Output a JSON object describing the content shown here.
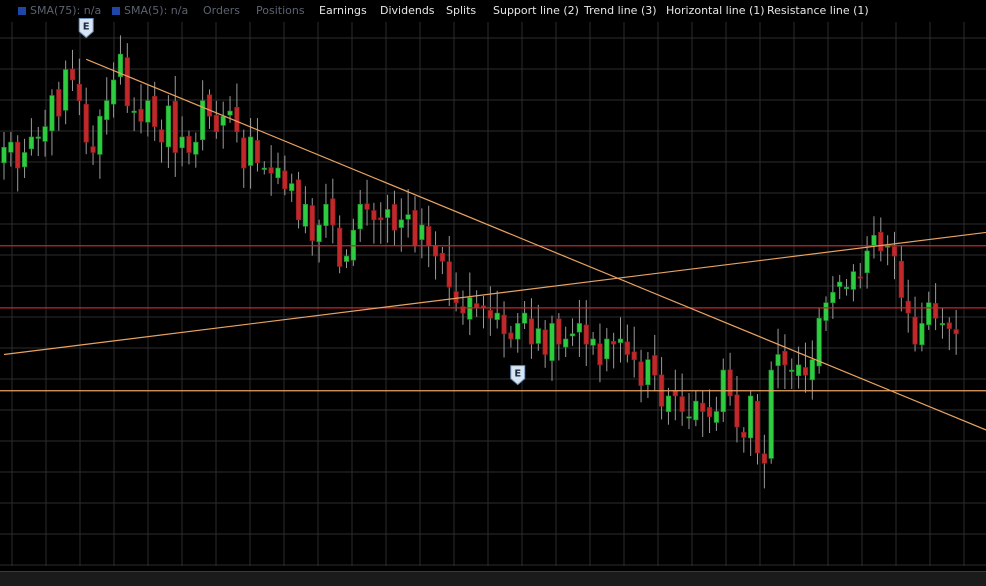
{
  "toolbar": {
    "items": [
      {
        "label": "SMA(75): n/a",
        "swatch": "#1e46a8",
        "style": "dim"
      },
      {
        "label": "SMA(5): n/a",
        "swatch": "#1e46a8",
        "style": "dim"
      },
      {
        "label": "Orders",
        "style": "dim"
      },
      {
        "label": "Positions",
        "style": "dim"
      },
      {
        "label": "Earnings",
        "style": "bright"
      },
      {
        "label": "Dividends",
        "style": "bright"
      },
      {
        "label": "Splits",
        "style": "bright"
      },
      {
        "label": "Support line (2)",
        "style": "bright"
      },
      {
        "label": "Trend line (3)",
        "style": "bright"
      },
      {
        "label": "Horizontal line (1)",
        "style": "bright"
      },
      {
        "label": "Resistance line (1)",
        "style": "bright"
      }
    ]
  },
  "chart_data": {
    "type": "candlestick",
    "colors": {
      "up": "#2ecc40",
      "down": "#c0282a",
      "wick": "#9a9a9a",
      "grid": "#2c2c2c",
      "trend": "#e8a262",
      "resistance": "#c0282a",
      "support": "#e8a262"
    },
    "ylim": [
      0,
      100
    ],
    "grid": true,
    "candles_count": 139,
    "closes": [
      76,
      77,
      72,
      75,
      78,
      78,
      80,
      86,
      82,
      91,
      89,
      85,
      77,
      75,
      82,
      85,
      89,
      94,
      84,
      83,
      81,
      85,
      80,
      77,
      84,
      75,
      78,
      75,
      77,
      85,
      82,
      79,
      82,
      83,
      79,
      72,
      78,
      73,
      72,
      71,
      72,
      68,
      69,
      62,
      65,
      58,
      61,
      65,
      61,
      53,
      55,
      60,
      65,
      64,
      62,
      62,
      64,
      60,
      62,
      63,
      57,
      61,
      57,
      55,
      54,
      49,
      46,
      44,
      47,
      45,
      45,
      43,
      44,
      40,
      39,
      42,
      44,
      38,
      41,
      36,
      42,
      38,
      39,
      40,
      42,
      38,
      39,
      34,
      39,
      38,
      39,
      36,
      35,
      30,
      35,
      32,
      26,
      28,
      28,
      25,
      24,
      27,
      25,
      24,
      25,
      33,
      28,
      22,
      20,
      28,
      17,
      15,
      33,
      36,
      34,
      33,
      34,
      32,
      35,
      43,
      46,
      48,
      50,
      49,
      52,
      51,
      56,
      59,
      56,
      57,
      55,
      47,
      44,
      38,
      42,
      46,
      43,
      42,
      41,
      40
    ],
    "events": [
      {
        "label": "E",
        "candle_index": 12,
        "price": 97
      },
      {
        "label": "E",
        "candle_index": 75,
        "price": 30
      }
    ],
    "trend_lines": [
      {
        "from": [
          12,
          93
        ],
        "to": [
          146,
          20
        ]
      },
      {
        "from": [
          0,
          36
        ],
        "to": [
          146,
          60
        ]
      }
    ],
    "horizontal_lines": [
      {
        "kind": "resistance",
        "price": 57
      },
      {
        "kind": "resistance",
        "price": 45
      },
      {
        "kind": "support",
        "price": 29
      }
    ]
  }
}
